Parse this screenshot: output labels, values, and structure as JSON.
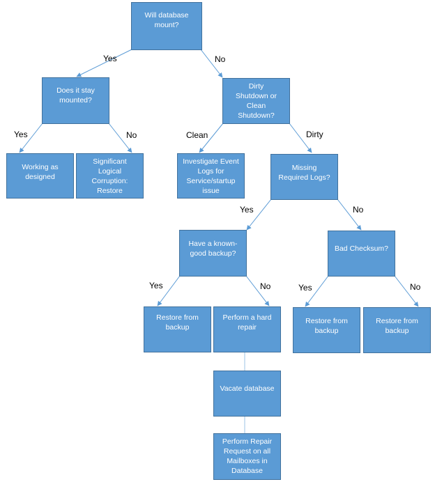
{
  "colors": {
    "node_fill": "#5b9bd5",
    "node_border": "#41719c",
    "node_text": "#ffffff",
    "edge": "#5b9bd5",
    "label_text": "#000000"
  },
  "nodes": {
    "root": "Will database mount?",
    "stay_mounted": "Does it stay mounted?",
    "working": "Working as designed",
    "corruption": "Significant Logical Corruption: Restore",
    "shutdown": "Dirty Shutdown or Clean Shutdown?",
    "investigate": "Investigate Event Logs for Service/startup issue",
    "missing_logs": "Missing Required Logs?",
    "known_good": "Have a known-good backup?",
    "bad_checksum": "Bad Checksum?",
    "restore_1": "Restore from backup",
    "hard_repair": "Perform a hard repair",
    "restore_2": "Restore from backup",
    "restore_3": "Restore from backup",
    "vacate": "Vacate database",
    "repair_request": "Perform Repair Request on all Mailboxes in Database"
  },
  "edges": [
    {
      "from": "root",
      "to": "stay_mounted",
      "label": "Yes"
    },
    {
      "from": "root",
      "to": "shutdown",
      "label": "No"
    },
    {
      "from": "stay_mounted",
      "to": "working",
      "label": "Yes"
    },
    {
      "from": "stay_mounted",
      "to": "corruption",
      "label": "No"
    },
    {
      "from": "shutdown",
      "to": "investigate",
      "label": "Clean"
    },
    {
      "from": "shutdown",
      "to": "missing_logs",
      "label": "Dirty"
    },
    {
      "from": "missing_logs",
      "to": "known_good",
      "label": "Yes"
    },
    {
      "from": "missing_logs",
      "to": "bad_checksum",
      "label": "No"
    },
    {
      "from": "known_good",
      "to": "restore_1",
      "label": "Yes"
    },
    {
      "from": "known_good",
      "to": "hard_repair",
      "label": "No"
    },
    {
      "from": "bad_checksum",
      "to": "restore_2",
      "label": "Yes"
    },
    {
      "from": "bad_checksum",
      "to": "restore_3",
      "label": "No"
    },
    {
      "from": "hard_repair",
      "to": "vacate",
      "label": ""
    },
    {
      "from": "vacate",
      "to": "repair_request",
      "label": ""
    }
  ],
  "labels": {
    "root_yes": "Yes",
    "root_no": "No",
    "stay_yes": "Yes",
    "stay_no": "No",
    "shutdown_clean": "Clean",
    "shutdown_dirty": "Dirty",
    "logs_yes": "Yes",
    "logs_no": "No",
    "backup_yes": "Yes",
    "backup_no": "No",
    "checksum_yes": "Yes",
    "checksum_no": "No"
  }
}
